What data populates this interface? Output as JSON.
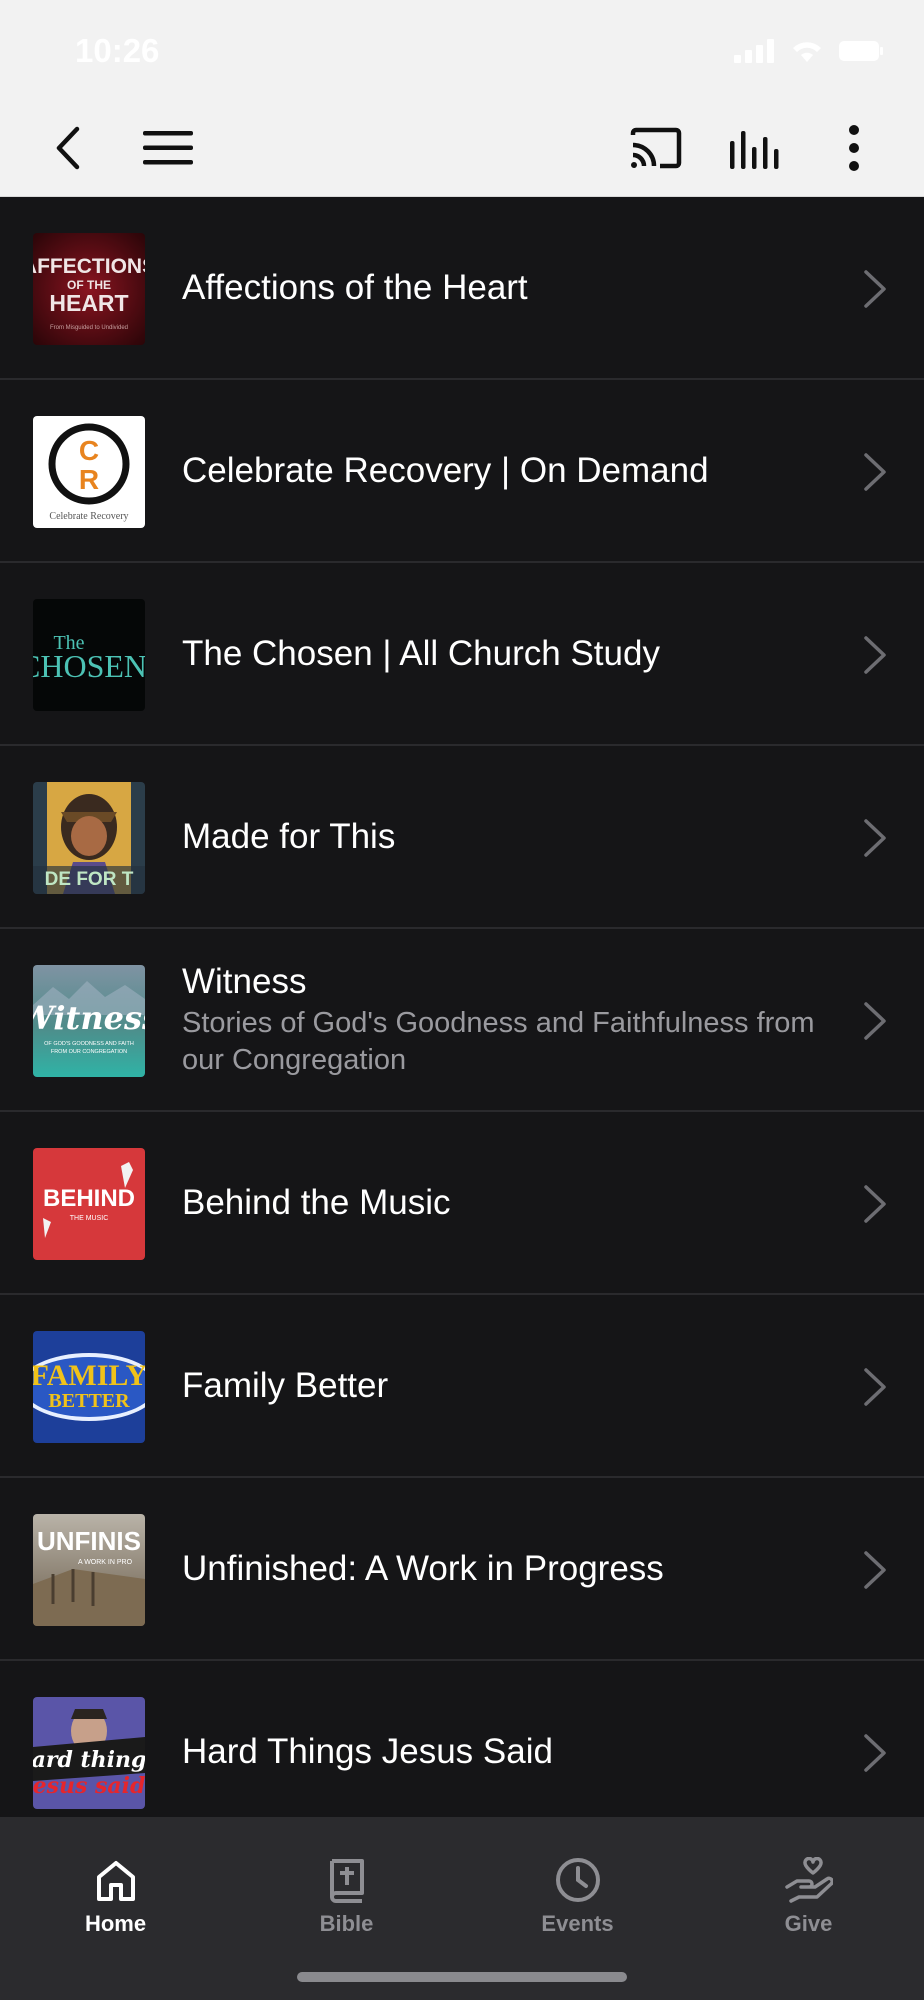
{
  "status": {
    "time": "10:26"
  },
  "toolbar": {
    "back_icon": "chevron-left-icon",
    "menu_icon": "hamburger-icon",
    "cast_icon": "cast-icon",
    "audio_icon": "audio-bars-icon",
    "more_icon": "more-vertical-icon"
  },
  "items": [
    {
      "title": "Affections of the Heart",
      "subtitle": "",
      "thumb": {
        "lines": [
          "AFFECTIONS",
          "OF THE",
          "HEART",
          "From Misguided to Undivided"
        ]
      }
    },
    {
      "title": "Celebrate Recovery | On Demand",
      "subtitle": "",
      "thumb": {
        "letters": [
          "C",
          "R"
        ],
        "caption": "Celebrate Recovery"
      }
    },
    {
      "title": "The Chosen | All  Church Study",
      "subtitle": "",
      "thumb": {
        "lines": [
          "The",
          "CHOSEN"
        ]
      }
    },
    {
      "title": "Made for This",
      "subtitle": "",
      "thumb": {
        "lines": [
          "DE FOR T"
        ]
      }
    },
    {
      "title": "Witness",
      "subtitle": "Stories of God's Goodness and Faithfulness from our Congregation",
      "thumb": {
        "lines": [
          "Witness",
          "OF GOD'S GOODNESS AND FAITH",
          "FROM OUR CONGREGATION"
        ]
      }
    },
    {
      "title": "Behind the Music",
      "subtitle": "",
      "thumb": {
        "lines": [
          "BEHIND",
          "THE MUSIC"
        ]
      }
    },
    {
      "title": "Family Better",
      "subtitle": "",
      "thumb": {
        "lines": [
          "FAMILY",
          "BETTER"
        ]
      }
    },
    {
      "title": "Unfinished: A Work in Progress",
      "subtitle": "",
      "thumb": {
        "lines": [
          "UNFINIS",
          "A WORK IN PRO"
        ]
      }
    },
    {
      "title": "Hard Things Jesus Said",
      "subtitle": "",
      "thumb": {
        "lines": [
          "ard thing",
          "esus said"
        ]
      }
    }
  ],
  "tabs": [
    {
      "label": "Home",
      "icon": "home-icon",
      "active": true
    },
    {
      "label": "Bible",
      "icon": "bible-icon",
      "active": false
    },
    {
      "label": "Events",
      "icon": "clock-icon",
      "active": false
    },
    {
      "label": "Give",
      "icon": "give-hand-heart-icon",
      "active": false
    }
  ],
  "colors": {
    "background": "#151517",
    "toolbar": "#f2f2f2",
    "tabbar": "#2b2b2e",
    "inactive": "#8e8e93"
  }
}
